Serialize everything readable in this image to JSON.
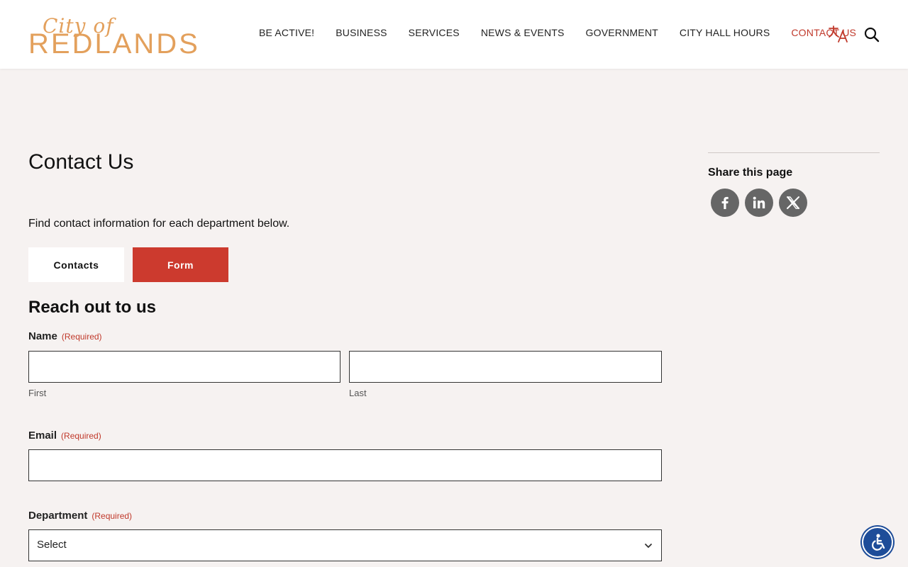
{
  "logo": {
    "script": "City of",
    "main": "REDLANDS"
  },
  "nav": {
    "items": [
      {
        "label": "BE ACTIVE!"
      },
      {
        "label": "BUSINESS"
      },
      {
        "label": "SERVICES"
      },
      {
        "label": "NEWS & EVENTS"
      },
      {
        "label": "GOVERNMENT"
      },
      {
        "label": "CITY HALL HOURS"
      },
      {
        "label": "CONTACT US"
      }
    ],
    "translate_icon": "translate-icon",
    "search_icon": "search-icon"
  },
  "main": {
    "title": "Contact Us",
    "intro": "Find contact information for each department below.",
    "tabs": [
      {
        "label": "Contacts"
      },
      {
        "label": "Form"
      }
    ],
    "section_title": "Reach out to us"
  },
  "form": {
    "name": {
      "label": "Name",
      "required": "(Required)",
      "first_label": "First",
      "last_label": "Last",
      "first_value": "",
      "last_value": ""
    },
    "email": {
      "label": "Email",
      "required": "(Required)",
      "value": ""
    },
    "department": {
      "label": "Department",
      "required": "(Required)",
      "selected": "Select"
    }
  },
  "sidebar": {
    "share_title": "Share this page",
    "social": [
      {
        "icon": "facebook-icon"
      },
      {
        "icon": "linkedin-icon"
      },
      {
        "icon": "x-icon"
      }
    ]
  },
  "colors": {
    "accent": "#cc3a2e",
    "logo": "#e3a05c",
    "background": "#f6f2f1",
    "social": "#666666",
    "accessibility": "#1e4d99"
  }
}
